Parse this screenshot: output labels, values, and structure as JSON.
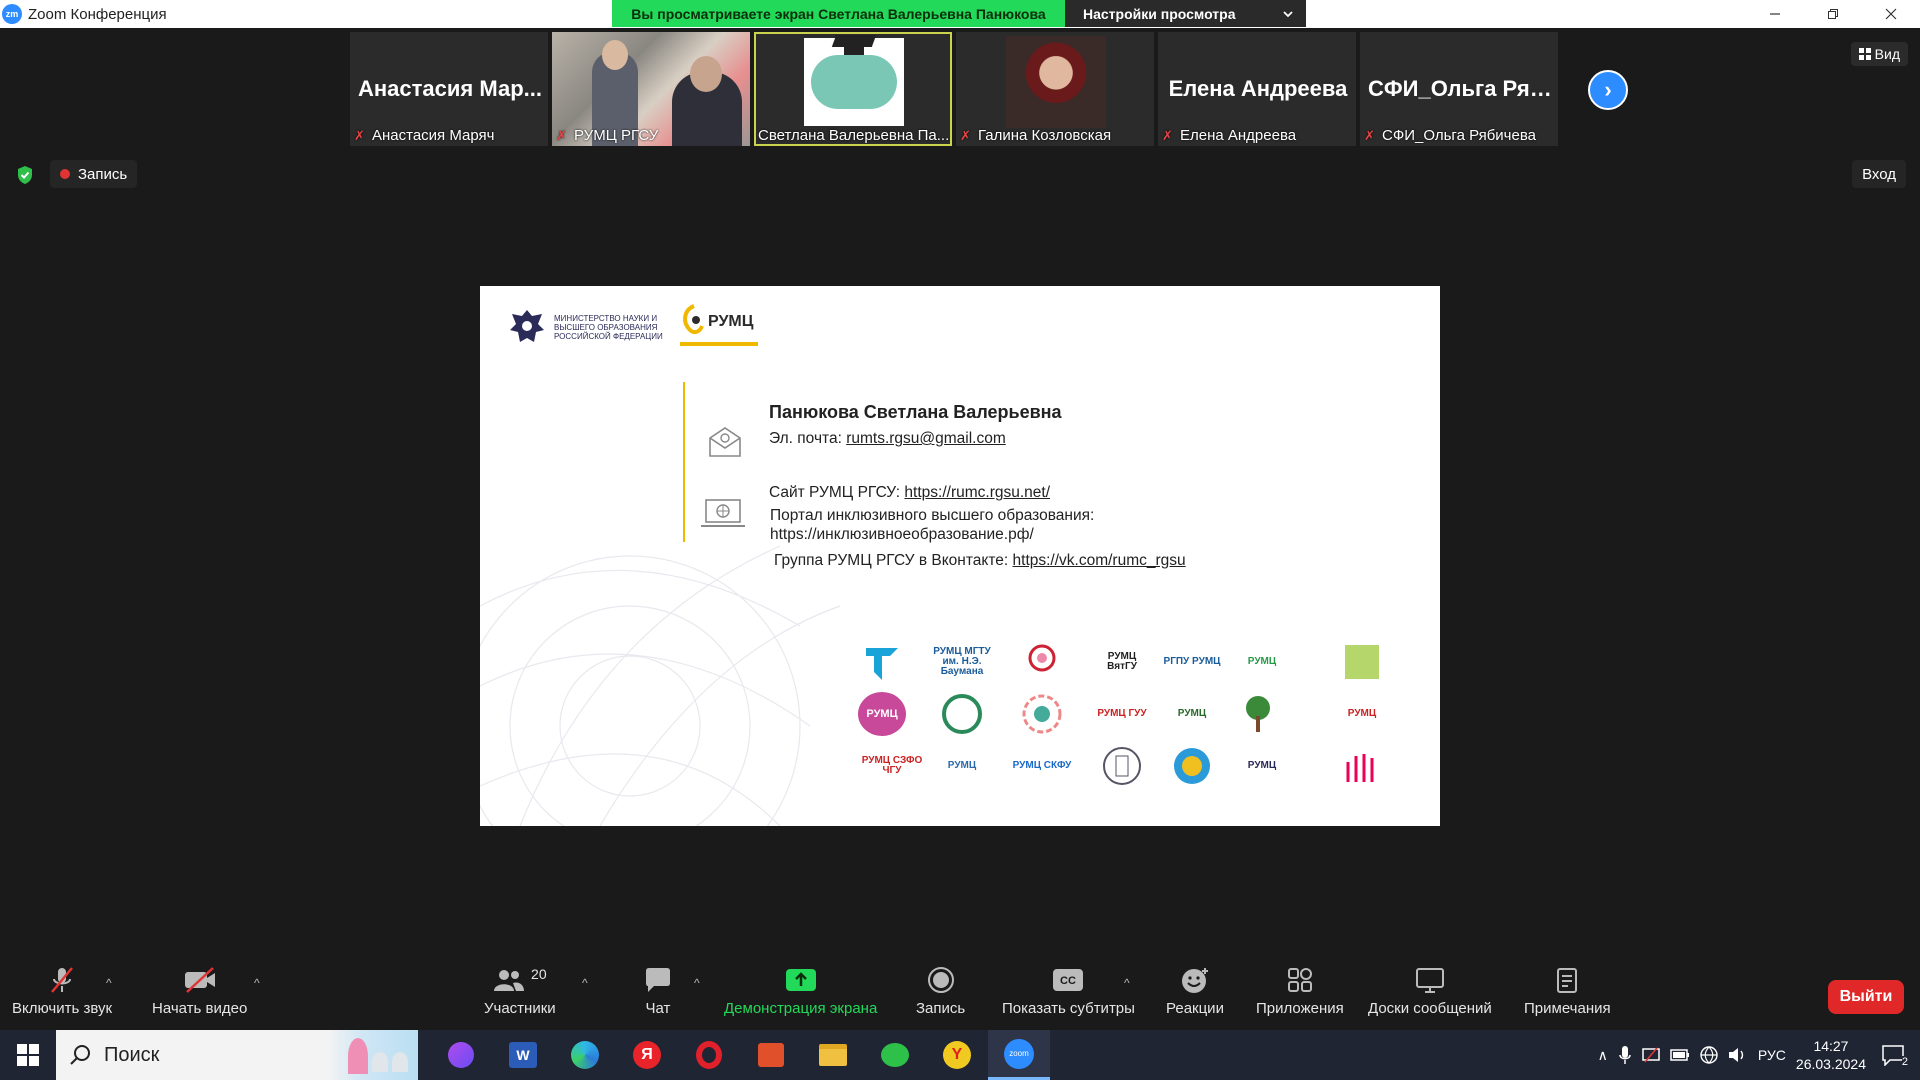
{
  "titlebar": {
    "app_icon": "zm",
    "title": "Zoom Конференция",
    "banner_text": "Вы просматриваете экран Светлана Валерьевна Панюкова",
    "view_settings": "Настройки просмотра"
  },
  "participants": [
    {
      "big_name": "Анастасия  Мар...",
      "label": "Анастасия Маряч",
      "muted": true,
      "video": false
    },
    {
      "big_name": "",
      "label": "РУМЦ РГСУ",
      "muted": true,
      "video": true
    },
    {
      "big_name": "",
      "label": "Светлана Валерьевна Па...",
      "muted": false,
      "video": true,
      "active": true
    },
    {
      "big_name": "",
      "label": "Галина Козловская",
      "muted": true,
      "video": true
    },
    {
      "big_name": "Елена Андреева",
      "label": "Елена Андреева",
      "muted": true,
      "video": false
    },
    {
      "big_name": "СФИ_Ольга Ряб...",
      "label": "СФИ_Ольга Рябичева",
      "muted": true,
      "video": false
    }
  ],
  "view_button": "Вид",
  "recording_label": "Запись",
  "enter_label": "Вход",
  "slide": {
    "ministry_text": "Министерство науки и высшего образования Российской Федерации",
    "rumc_logo": "РУМЦ",
    "name": "Панюкова Светлана Валерьевна",
    "email_label": "Эл. почта: ",
    "email": "rumts.rgsu@gmail.com",
    "site_label": "Сайт РУМЦ РГСУ: ",
    "site_url": "https://rumc.rgsu.net/",
    "portal_label": "Портал инклюзивного высшего образования:",
    "portal_url": "https://инклюзивноеобразование.рф/",
    "vk_label": "Группа РУМЦ РГСУ в Вконтакте: ",
    "vk_url": "https://vk.com/rumc_rgsu",
    "logos": [
      "ТюмГУ",
      "РУМЦ МГТУ им. Н.Э. Баумана",
      "",
      "РУМЦ ВятГУ",
      "РГПУ РУМЦ",
      "РУМЦ",
      "",
      "РУМЦ",
      "",
      "",
      "РУМЦ ГУУ",
      "РУМЦ",
      "",
      "РУМЦ",
      "РУМЦ СЗФО ЧГУ",
      "РУМЦ",
      "РУМЦ СКФУ",
      "",
      "",
      "РУМЦ",
      ""
    ]
  },
  "toolbar": {
    "unmute": "Включить звук",
    "start_video": "Начать видео",
    "participants": "Участники",
    "participants_count": "20",
    "chat": "Чат",
    "share": "Демонстрация экрана",
    "record": "Запись",
    "captions": "Показать субтитры",
    "reactions": "Реакции",
    "apps": "Приложения",
    "whiteboards": "Доски сообщений",
    "notes": "Примечания",
    "leave": "Выйти"
  },
  "taskbar": {
    "search_placeholder": "Поиск",
    "lang": "РУС",
    "time": "14:27",
    "date": "26.03.2024",
    "notifications": "2"
  },
  "colors": {
    "share_green": "#23d959",
    "accent_blue": "#2d8cff",
    "leave_red": "#e02828",
    "slide_accent": "#f0b800"
  }
}
